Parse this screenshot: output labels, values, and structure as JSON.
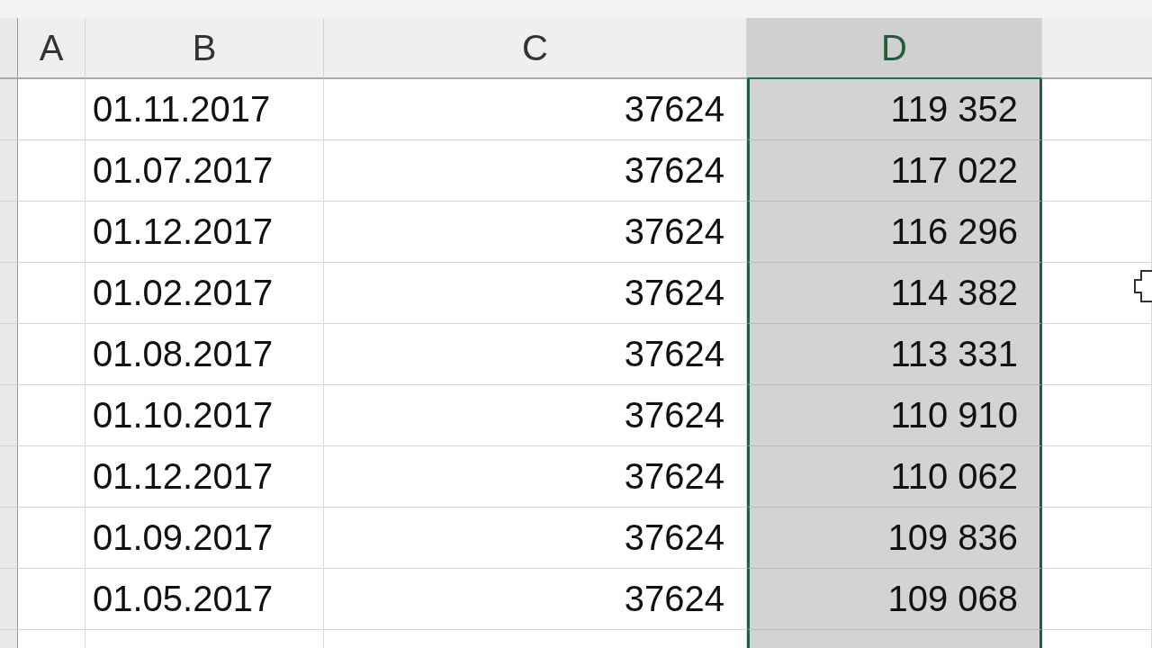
{
  "columns": [
    {
      "label": "A",
      "selected": false
    },
    {
      "label": "B",
      "selected": false
    },
    {
      "label": "C",
      "selected": false
    },
    {
      "label": "D",
      "selected": true
    }
  ],
  "rows": [
    {
      "cells": [
        "",
        "01.11.2017",
        "37624",
        "119 352"
      ]
    },
    {
      "cells": [
        "",
        "01.07.2017",
        "37624",
        "117 022"
      ]
    },
    {
      "cells": [
        "",
        "01.12.2017",
        "37624",
        "116 296"
      ]
    },
    {
      "cells": [
        "",
        "01.02.2017",
        "37624",
        "114 382"
      ]
    },
    {
      "cells": [
        "",
        "01.08.2017",
        "37624",
        "113 331"
      ]
    },
    {
      "cells": [
        "",
        "01.10.2017",
        "37624",
        "110 910"
      ]
    },
    {
      "cells": [
        "",
        "01.12.2017",
        "37624",
        "110 062"
      ]
    },
    {
      "cells": [
        "",
        "01.09.2017",
        "37624",
        "109 836"
      ]
    },
    {
      "cells": [
        "",
        "01.05.2017",
        "37624",
        "109 068"
      ]
    }
  ]
}
